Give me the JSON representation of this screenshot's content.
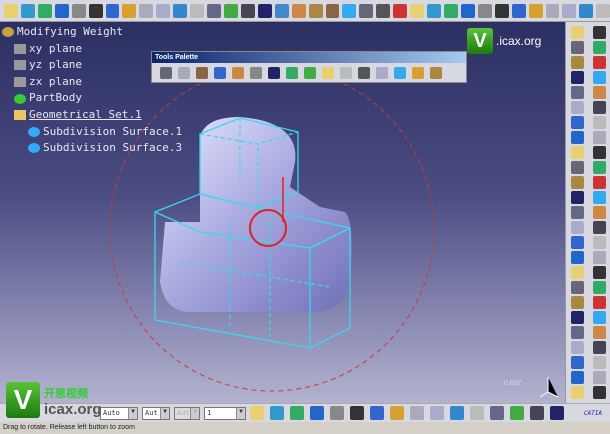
{
  "tree": {
    "root": "Modifying Weight",
    "items": [
      "xy plane",
      "yz plane",
      "zx plane",
      "PartBody",
      "Geometrical Set.1",
      "Subdivision Surface.1",
      "Subdivision Surface.3"
    ]
  },
  "palette": {
    "title": "Tools Palette"
  },
  "logo": {
    "v": "V",
    "site": ".icax.org",
    "cn": "开思视频",
    "site2": "icax.org"
  },
  "viewport": {
    "zoom_readout": "0.657"
  },
  "bottom_toolbar": {
    "selects": [
      "Auto",
      "Aut",
      "Aut",
      "1"
    ]
  },
  "status": {
    "message": "Drag to rotate. Release left button to zoom"
  },
  "brand": {
    "catia": "CATIA"
  },
  "colors": {
    "wireframe": "#38d8f0",
    "compass_circle": "#e03030",
    "surface": "#b8b8ea"
  }
}
